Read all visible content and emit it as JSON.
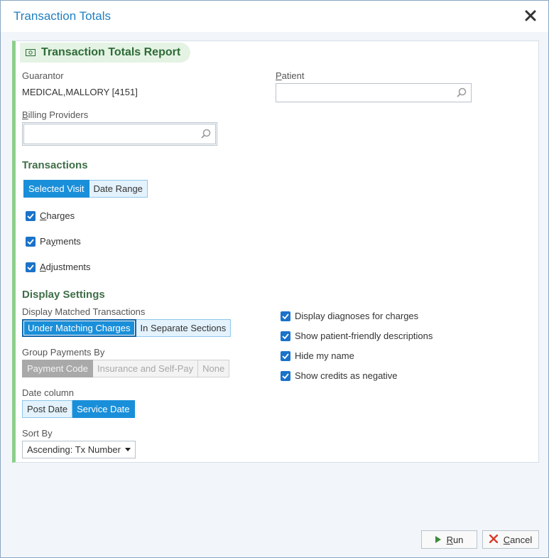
{
  "window": {
    "title": "Transaction Totals"
  },
  "report": {
    "title": "Transaction Totals Report"
  },
  "guarantor": {
    "label": "Guarantor",
    "value": "MEDICAL,MALLORY [4151]"
  },
  "patient": {
    "label": "Patient",
    "value": ""
  },
  "billing_providers": {
    "label": "Billing Providers",
    "value": ""
  },
  "transactions": {
    "heading": "Transactions",
    "range_options": [
      "Selected Visit",
      "Date Range"
    ],
    "range_selected": "Selected Visit",
    "checks": [
      {
        "label": "Charges",
        "checked": true
      },
      {
        "label": "Payments",
        "checked": true
      },
      {
        "label": "Adjustments",
        "checked": true
      }
    ]
  },
  "display_settings": {
    "heading": "Display Settings",
    "matched_label": "Display Matched Transactions",
    "matched_options": [
      "Under Matching Charges",
      "In Separate Sections"
    ],
    "matched_selected": "Under Matching Charges",
    "group_label": "Group Payments By",
    "group_options": [
      "Payment Code",
      "Insurance and Self-Pay",
      "None"
    ],
    "group_selected": "Payment Code",
    "group_disabled": true,
    "date_label": "Date column",
    "date_options": [
      "Post Date",
      "Service Date"
    ],
    "date_selected": "Service Date",
    "sort_label": "Sort By",
    "sort_value": "Ascending: Tx Number",
    "options": [
      {
        "label": "Display diagnoses for charges",
        "checked": true
      },
      {
        "label": "Show patient-friendly descriptions",
        "checked": true
      },
      {
        "label": "Hide my name",
        "checked": true
      },
      {
        "label": "Show credits as negative",
        "checked": true
      }
    ]
  },
  "footer": {
    "run_label": "Run",
    "cancel_label": "Cancel"
  },
  "colors": {
    "accent": "#1a8fd9",
    "title": "#1f7fc0",
    "section_green": "#3f6e48",
    "panel_stripe": "#8dcf8a"
  }
}
